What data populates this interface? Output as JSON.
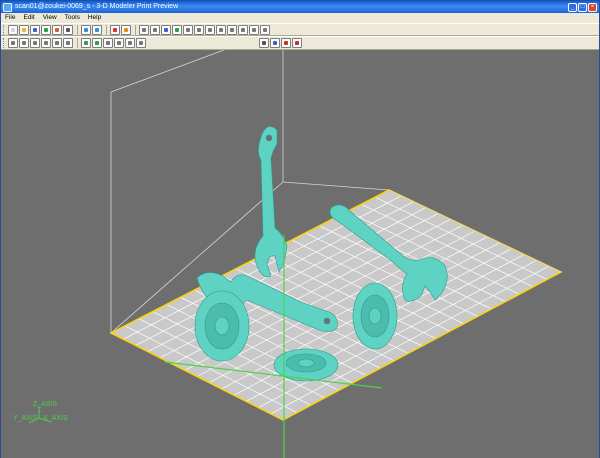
{
  "window": {
    "title": "scan01@zoukei-0069_s - 3-D Modeler Print Preview",
    "minimize_label": "_",
    "maximize_label": "□",
    "close_label": "×"
  },
  "menu": [
    "File",
    "Edit",
    "View",
    "Tools",
    "Help"
  ],
  "toolbar1": {
    "left_icons": [
      "new-doc",
      "open-folder",
      "save-disk",
      "import-model",
      "export-model",
      "print-icon"
    ],
    "view_icons": [
      "zoom-fit",
      "zoom-in",
      "zoom-out",
      "rotate",
      "orbit",
      "pan"
    ],
    "nav_icons": [
      "arrow-up",
      "arrow-left",
      "arrow-right",
      "arrow-down",
      "home-view",
      "front-view",
      "top-view",
      "side-view",
      "iso-view"
    ]
  },
  "toolbar2": {
    "tool_icons": [
      "select-tool",
      "move-tool",
      "scale-tool",
      "rotate-tool",
      "mirror-tool",
      "duplicate-tool",
      "align-tool",
      "layout-tool",
      "pack-tool",
      "delete-tool",
      "undo",
      "redo"
    ],
    "print_icons": [
      "print-settings",
      "slice-preview",
      "material-icon",
      "stop-icon"
    ]
  },
  "colors": {
    "viewport_bg": "#6e6e6e",
    "build_plate": "#c9c9c9",
    "plate_edge": "#ffd400",
    "model": "#5ed2c3",
    "axis": "#4dd24d",
    "box_lines": "#d6d6d6"
  },
  "axes": {
    "z": "Z_AXIS",
    "y": "Y_AXIS",
    "x": "X_AXIS"
  }
}
